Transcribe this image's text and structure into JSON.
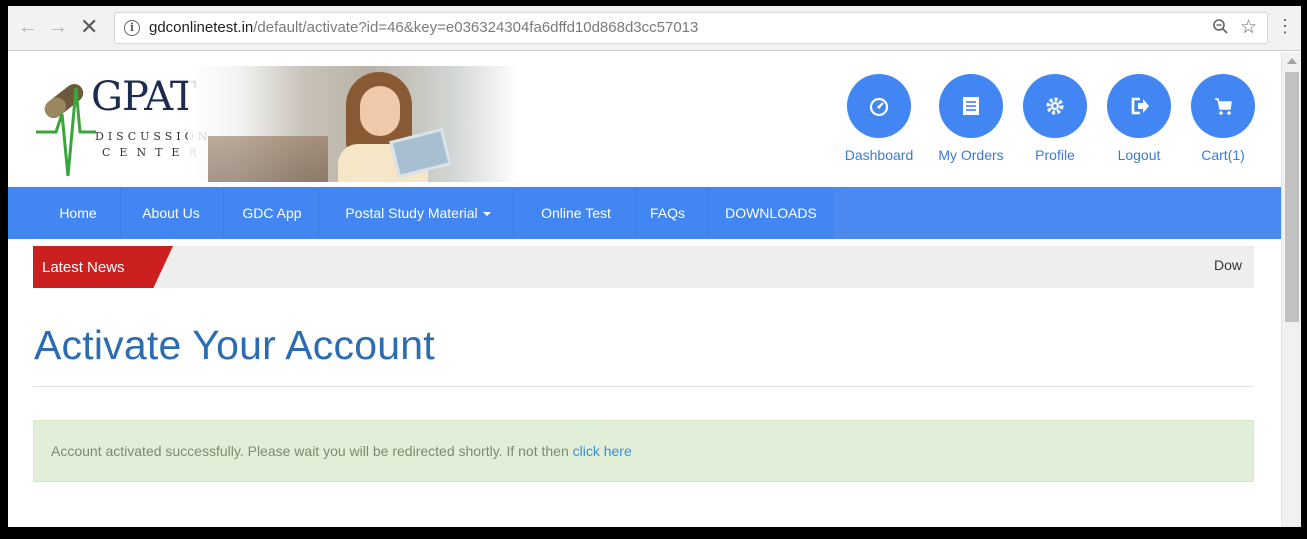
{
  "browser": {
    "url_host": "gdconlinetest.in",
    "url_path": "/default/activate?id=46&key=e036324304fa6dffd10d868d3cc57013",
    "icons": [
      "back-arrow-icon",
      "forward-arrow-icon",
      "stop-icon",
      "info-icon",
      "zoom-icon",
      "star-icon",
      "menu-icon"
    ]
  },
  "logo": {
    "title": "GPAT",
    "line1": "DISCUSSION",
    "line2": "CENTER"
  },
  "header_nav": [
    {
      "label": "Dashboard",
      "icon": "dashboard-icon"
    },
    {
      "label": "My Orders",
      "icon": "orders-list-icon"
    },
    {
      "label": "Profile",
      "icon": "gear-icon"
    },
    {
      "label": "Logout",
      "icon": "logout-icon"
    },
    {
      "label": "Cart(1)",
      "icon": "cart-icon"
    }
  ],
  "main_nav": [
    {
      "label": "Home"
    },
    {
      "label": "About Us"
    },
    {
      "label": "GDC App"
    },
    {
      "label": "Postal Study Material",
      "has_dropdown": true
    },
    {
      "label": "Online Test"
    },
    {
      "label": "FAQs"
    },
    {
      "label": "DOWNLOADS"
    }
  ],
  "news": {
    "label": "Latest News",
    "ticker": "Dow"
  },
  "content": {
    "title": "Activate Your Account",
    "alert_text": "Account activated successfully. Please wait you will be redirected shortly. If not then ",
    "alert_link": "click here"
  },
  "colors": {
    "nav_blue": "#4286f4",
    "news_red": "#cc1f1f",
    "title_blue": "#2b6cb3",
    "alert_bg": "#e1efd9"
  }
}
